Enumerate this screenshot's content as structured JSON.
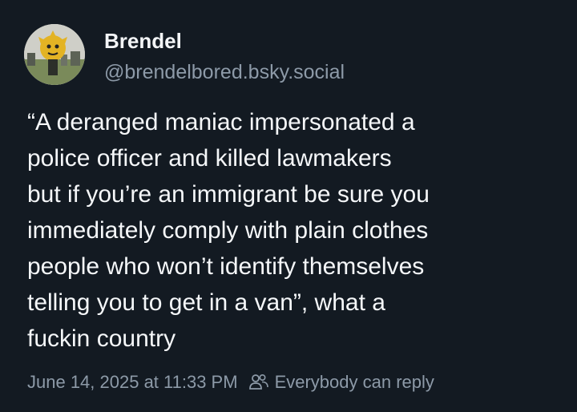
{
  "post": {
    "author": {
      "display_name": "Brendel",
      "handle": "@brendelbored.bsky.social",
      "avatar_icon": "avatar-image"
    },
    "text": "“A deranged maniac impersonated a\npolice officer and killed lawmakers\nbut if you’re an immigrant be sure you\nimmediately comply with plain clothes\npeople who won’t identify themselves\ntelling you to get in a van”, what a\nfuckin country",
    "timestamp": "June 14, 2025 at 11:33 PM",
    "reply_setting": {
      "icon": "people-icon",
      "label": "Everybody can reply"
    }
  },
  "colors": {
    "background": "#131a22",
    "primary_text": "#f5f7f9",
    "secondary_text": "#8d9aa8"
  }
}
